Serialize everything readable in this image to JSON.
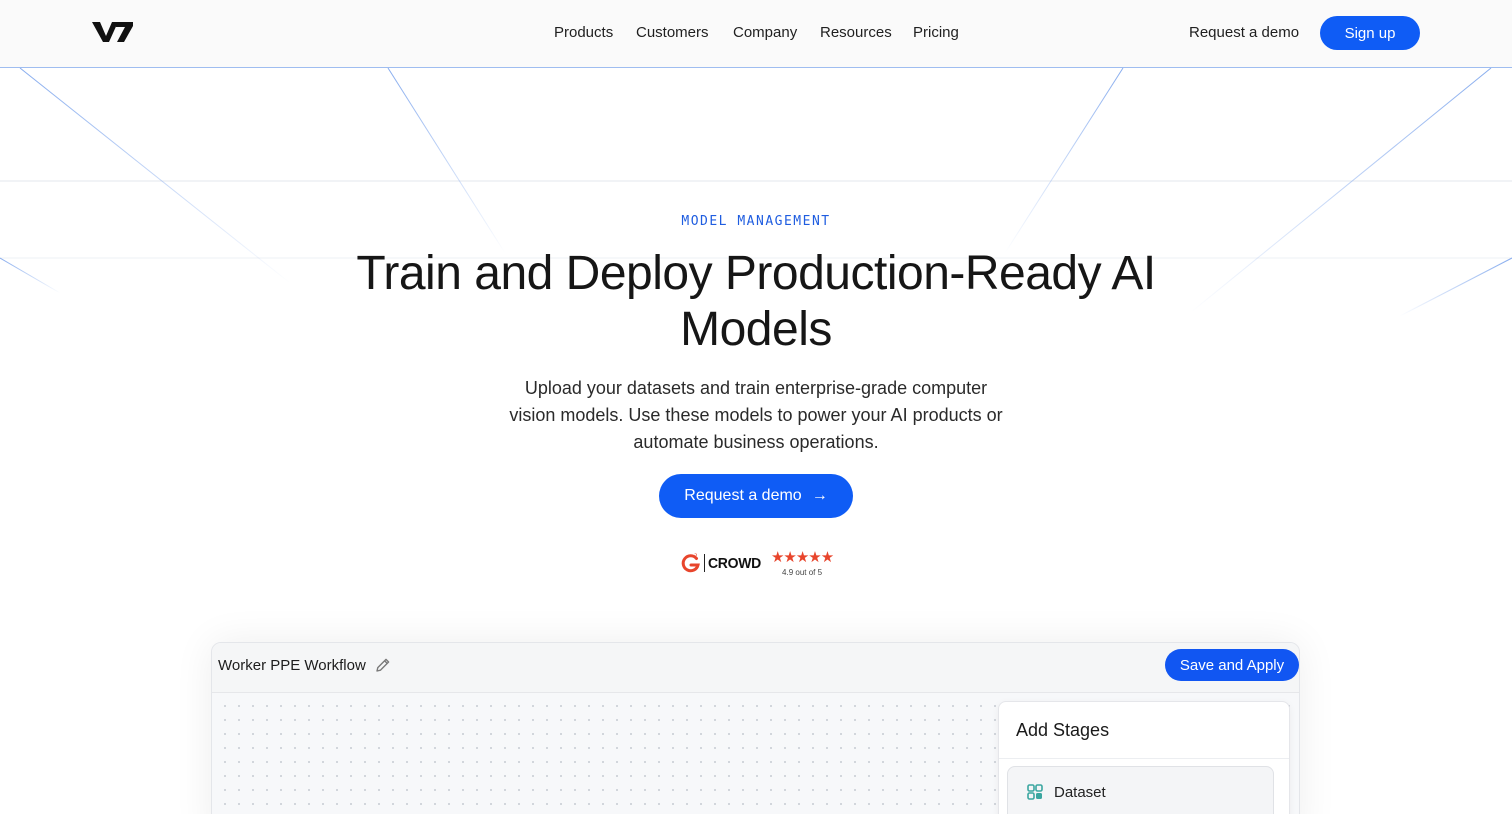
{
  "nav": {
    "logo_text": "V7",
    "links": [
      "Products",
      "Customers",
      "Company",
      "Resources",
      "Pricing"
    ],
    "demo_label": "Request a demo",
    "signup_label": "Sign up"
  },
  "hero": {
    "eyebrow": "MODEL MANAGEMENT",
    "title": "Train and Deploy Production-Ready AI Models",
    "subtitle": "Upload your datasets and train enterprise-grade computer vision models. Use these models to power your AI products or automate business operations.",
    "cta_label": "Request a demo"
  },
  "rating": {
    "brand": "CROWD",
    "stars": "★★★★★",
    "score": "4.9 out of 5"
  },
  "workflow": {
    "title": "Worker PPE Workflow",
    "save_label": "Save and Apply",
    "panel_title": "Add Stages",
    "stages": [
      {
        "label": "Dataset",
        "icon": "dataset-icon"
      }
    ]
  },
  "colors": {
    "accent": "#0f5cf5",
    "eyebrow": "#1f5de0",
    "star": "#e8452c",
    "line": "#9fbdf0"
  }
}
